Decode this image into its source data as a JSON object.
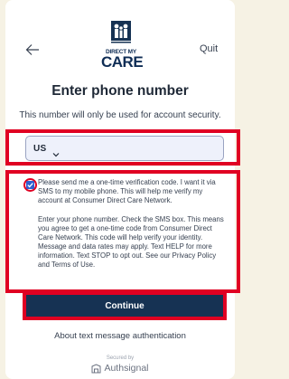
{
  "header": {
    "back_icon": "arrow-left-icon",
    "logo_line1": "DIRECT MY",
    "logo_line2": "CARE",
    "quit_label": "Quit"
  },
  "main": {
    "title": "Enter phone number",
    "subtitle": "This number will only be used for account security.",
    "country_code": "US",
    "country_chevron_icon": "chevron-down-icon",
    "consent_checked": true,
    "consent_text": "Please send me a one-time verification code. I want it via SMS to my mobile phone. This will help me verify my account at Consumer Direct Care Network.",
    "legal_text": "Enter your phone number. Check the SMS box. This means you agree to get a one-time code from Consumer Direct Care Network. This code will help verify your identity. Message and data rates may apply. Text HELP for more information. Text STOP to opt out. See our Privacy Policy and Terms of Use.",
    "continue_label": "Continue",
    "about_link": "About text message authentication"
  },
  "footer": {
    "secured_by": "Secured by",
    "brand": "Authsignal",
    "brand_icon": "authsignal-logo-icon"
  },
  "colors": {
    "accent": "#163253",
    "highlight": "#e00022",
    "checkbox": "#2f5fd0"
  }
}
